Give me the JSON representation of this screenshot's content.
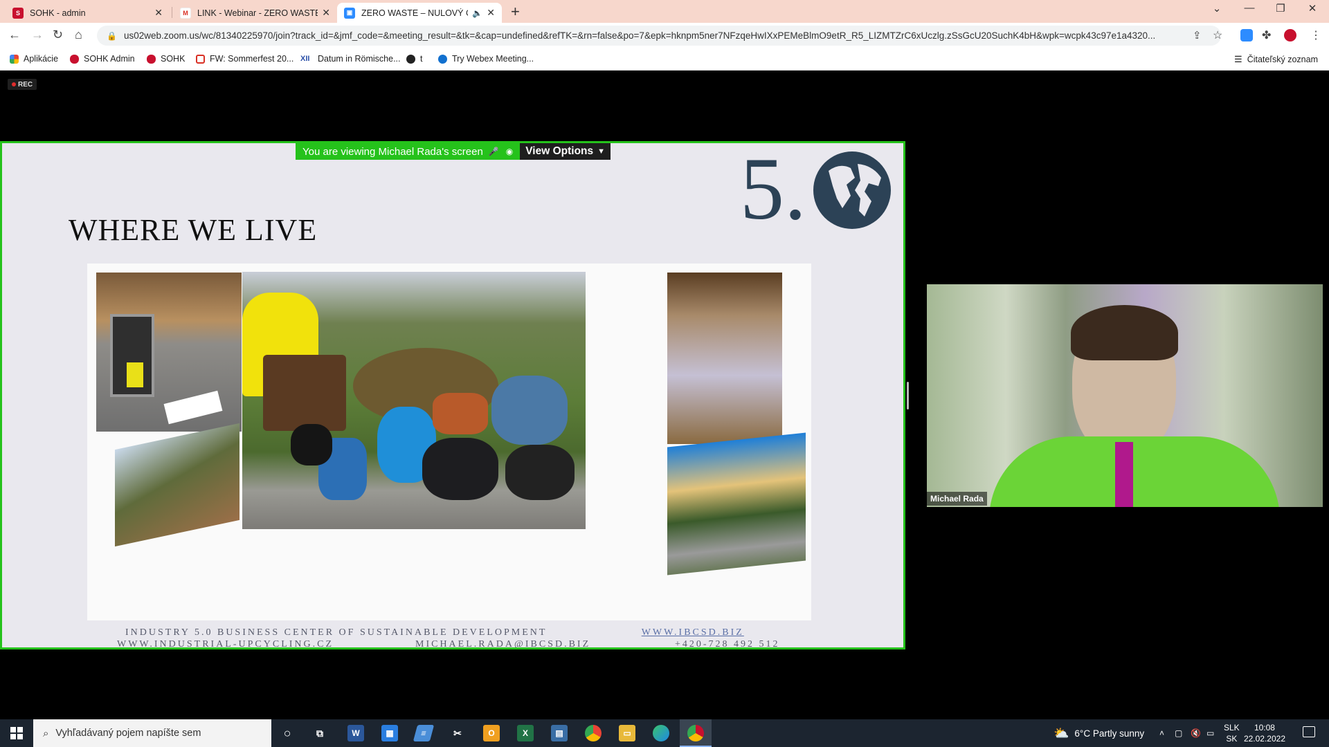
{
  "browser": {
    "tabs": [
      {
        "title": "SOHK - admin",
        "favicon": "sohk-icon",
        "active": false
      },
      {
        "title": "LINK - Webinar - ZERO WASTE - ",
        "favicon": "gmail-icon",
        "active": false
      },
      {
        "title": "ZERO WASTE – NULOVÝ OD",
        "favicon": "zoom-icon",
        "active": true
      }
    ],
    "url": "us02web.zoom.us/wc/81340225970/join?track_id=&jmf_code=&meeting_result=&tk=&cap=undefined&refTK=&rn=false&po=7&epk=hknpm5ner7NFzqeHwIXxPEMeBlmO9etR_R5_LIZMTZrC6xUczlg.zSsGcU20SuchK4bH&wpk=wcpk43c97e1a4320...",
    "bookmarks": [
      {
        "label": "Aplikácie",
        "icon": "apps-icon"
      },
      {
        "label": "SOHK Admin",
        "icon": "sohk-icon"
      },
      {
        "label": "SOHK",
        "icon": "sohk-icon"
      },
      {
        "label": "FW: Sommerfest 20...",
        "icon": "gmail-icon"
      },
      {
        "label": "Datum in Römische...",
        "icon": "roman-icon"
      },
      {
        "label": "t",
        "icon": "globe-icon"
      },
      {
        "label": "Try Webex Meeting...",
        "icon": "webex-icon"
      }
    ],
    "reading_list": "Čitateľský zoznam"
  },
  "meeting": {
    "rec_label": "REC",
    "banner_text": "You are viewing Michael Rada's screen",
    "view_options": "View Options",
    "participant_name": "Michael Rada"
  },
  "slide": {
    "title": "WHERE WE LIVE",
    "logo_text": "5.",
    "footer_line1": "INDUSTRY 5.0 BUSINESS CENTER OF SUSTAINABLE DEVELOPMENT",
    "footer_link1": "WWW.IBCSD.BIZ",
    "footer_line2_a": "WWW.INDUSTRIAL-UPCYCLING.CZ",
    "footer_line2_b": "MICHAEL.RADA@IBCSD.BIZ",
    "footer_line2_c": "+420-728 492 512"
  },
  "taskbar": {
    "search_placeholder": "Vyhľadávaný pojem napíšte sem",
    "weather": "6°C  Partly sunny",
    "lang_top": "SLK",
    "lang_bottom": "SK",
    "time": "10:08",
    "date": "22.02.2022"
  }
}
